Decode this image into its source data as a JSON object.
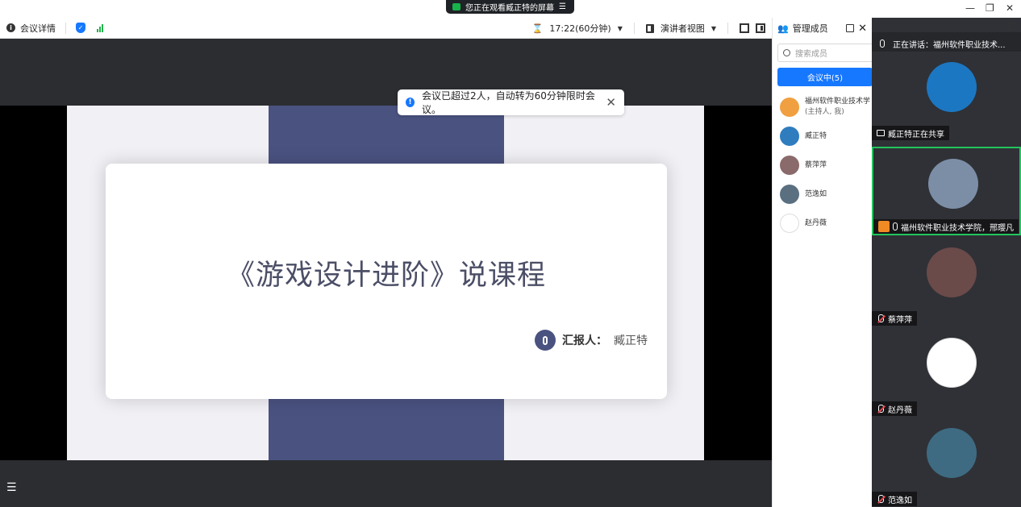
{
  "titlebar": {
    "sharing_notice": "您正在观看臧正特的屏幕",
    "minimize": "—",
    "restore": "❐",
    "close": "✕",
    "menu": "☰"
  },
  "toolbar": {
    "meeting_details": "会议详情",
    "timer": "17:22(60分钟)",
    "view_mode": "演讲者视图"
  },
  "toast": {
    "message": "会议已超过2人，自动转为60分钟限时会议。",
    "close": "✕"
  },
  "slide": {
    "title": "《游戏设计进阶》说课程",
    "reporter_label": "汇报人：",
    "reporter_name": "臧正特"
  },
  "members_panel": {
    "title": "管理成员",
    "search_placeholder": "搜索成员",
    "in_meeting_tab": "会议中(5)",
    "members": [
      {
        "name": "福州软件职业技术学",
        "sub": "(主持人, 我)",
        "avatar_color": "#f0a040"
      },
      {
        "name": "臧正特",
        "sub": "",
        "avatar_color": "#2f7dbf"
      },
      {
        "name": "蔡萍萍",
        "sub": "",
        "avatar_color": "#8a6a6a"
      },
      {
        "name": "范逸如",
        "sub": "",
        "avatar_color": "#5a7080"
      },
      {
        "name": "赵丹薇",
        "sub": "",
        "avatar_color": "#ffffff"
      }
    ]
  },
  "video_strip": {
    "speaking_now": "正在讲话：福州软件职业技术...",
    "tiles": [
      {
        "label": "臧正特正在共享",
        "avatar_color": "#1c77c3"
      },
      {
        "label": "福州软件职业技术学院，邢璎凡",
        "avatar_color": "#7c8ea6"
      },
      {
        "label": "蔡萍萍",
        "avatar_color": "#6b4a4a"
      },
      {
        "label": "赵丹薇",
        "avatar_color": "#ffffff"
      },
      {
        "label": "范逸如",
        "avatar_color": "#3e6b82"
      }
    ]
  },
  "colors": {
    "accent": "#1677ff",
    "active_border": "#22c55e",
    "slide_band": "#4a5280"
  }
}
